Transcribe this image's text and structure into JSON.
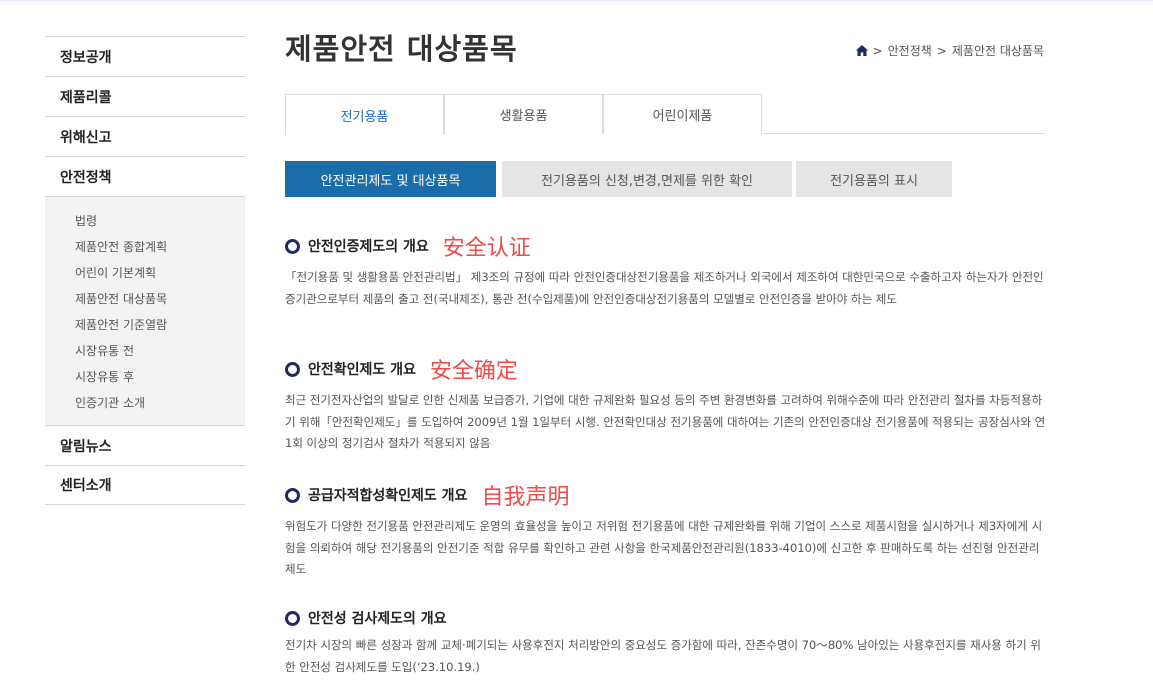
{
  "sidebar": {
    "items_top": [
      "정보공개",
      "제품리콜",
      "위해신고",
      "안전정책"
    ],
    "submenu": [
      "법령",
      "제품안전 종합계획",
      "어린이 기본계획",
      "제품안전 대상품목",
      "제품안전 기준열람",
      "시장유통 전",
      "시장유통 후",
      "인증기관 소개"
    ],
    "items_bottom": [
      "알림뉴스",
      "센터소개"
    ]
  },
  "header": {
    "title": "제품안전 대상품목",
    "breadcrumb": {
      "home_icon": "home-icon",
      "sep": ">",
      "items": [
        "안전정책",
        "제품안전 대상품목"
      ]
    }
  },
  "tabs": [
    "전기용품",
    "생활용품",
    "어린이제품"
  ],
  "subtabs": [
    "안전관리제도 및 대상품목",
    "전기용품의 신청,변경,면제를 위한 확인",
    "전기용품의 표시"
  ],
  "colors": {
    "accent": "#1a6da8",
    "annotation": "#f04a4a",
    "bullet": "#1f2b5e"
  },
  "sections": [
    {
      "title": "안전인증제도의 개요",
      "annotation": "安全认证",
      "body": "「전기용품 및 생활용품 안전관리법」 제3조의 규정에 따라 안전인증대상전기용품을 제조하거나 외국에서 제조하여 대한민국으로 수출하고자 하는자가 안전인증기관으로부터 제품의 출고 전(국내제조), 통관 전(수입제품)에 안전인증대상전기용품의 모델별로 안전인증을 받아야 하는 제도"
    },
    {
      "title": "안전확인제도 개요",
      "annotation": "安全确定",
      "body": "최근 전기전자산업의 발달로 인한 신제품 보급증가, 기업에 대한 규제완화 필요성 등의 주변 환경변화를 고려하여 위해수준에 따라 안전관리 절차를 차등적용하기 위해「안전확인제도」를 도입하여 2009년 1월 1일부터 시행. 안전확인대상 전기용품에 대하여는 기존의 안전인증대상 전기용품에 적용되는 공장심사와 연 1회 이상의 정기검사 절차가 적용되지 않음"
    },
    {
      "title": "공급자적합성확인제도 개요",
      "annotation": "自我声明",
      "body": "위험도가 다양한 전기용품 안전관리제도 운영의 효율성을 높이고 저위험 전기용품에 대한 규제완화를 위해 기업이 스스로 제품시험을 실시하거나 제3자에게 시험을 의뢰하여 해당 전기용품의 안전기준 적합 유무를 확인하고 관련 사항을 한국제품안전관리원(1833-4010)에 신고한 후 판매하도록 하는 선진형 안전관리제도"
    },
    {
      "title": "안전성 검사제도의 개요",
      "annotation": "",
      "body": "전기차 시장의 빠른 성장과 함께 교체·폐기되는 사용후전지 처리방안의 중요성도 증가함에 따라, 잔존수명이 70～80% 남아있는 사용후전지를 재사용 하기 위한 안전성 검사제도를 도입(‘23.10.19.)"
    }
  ]
}
